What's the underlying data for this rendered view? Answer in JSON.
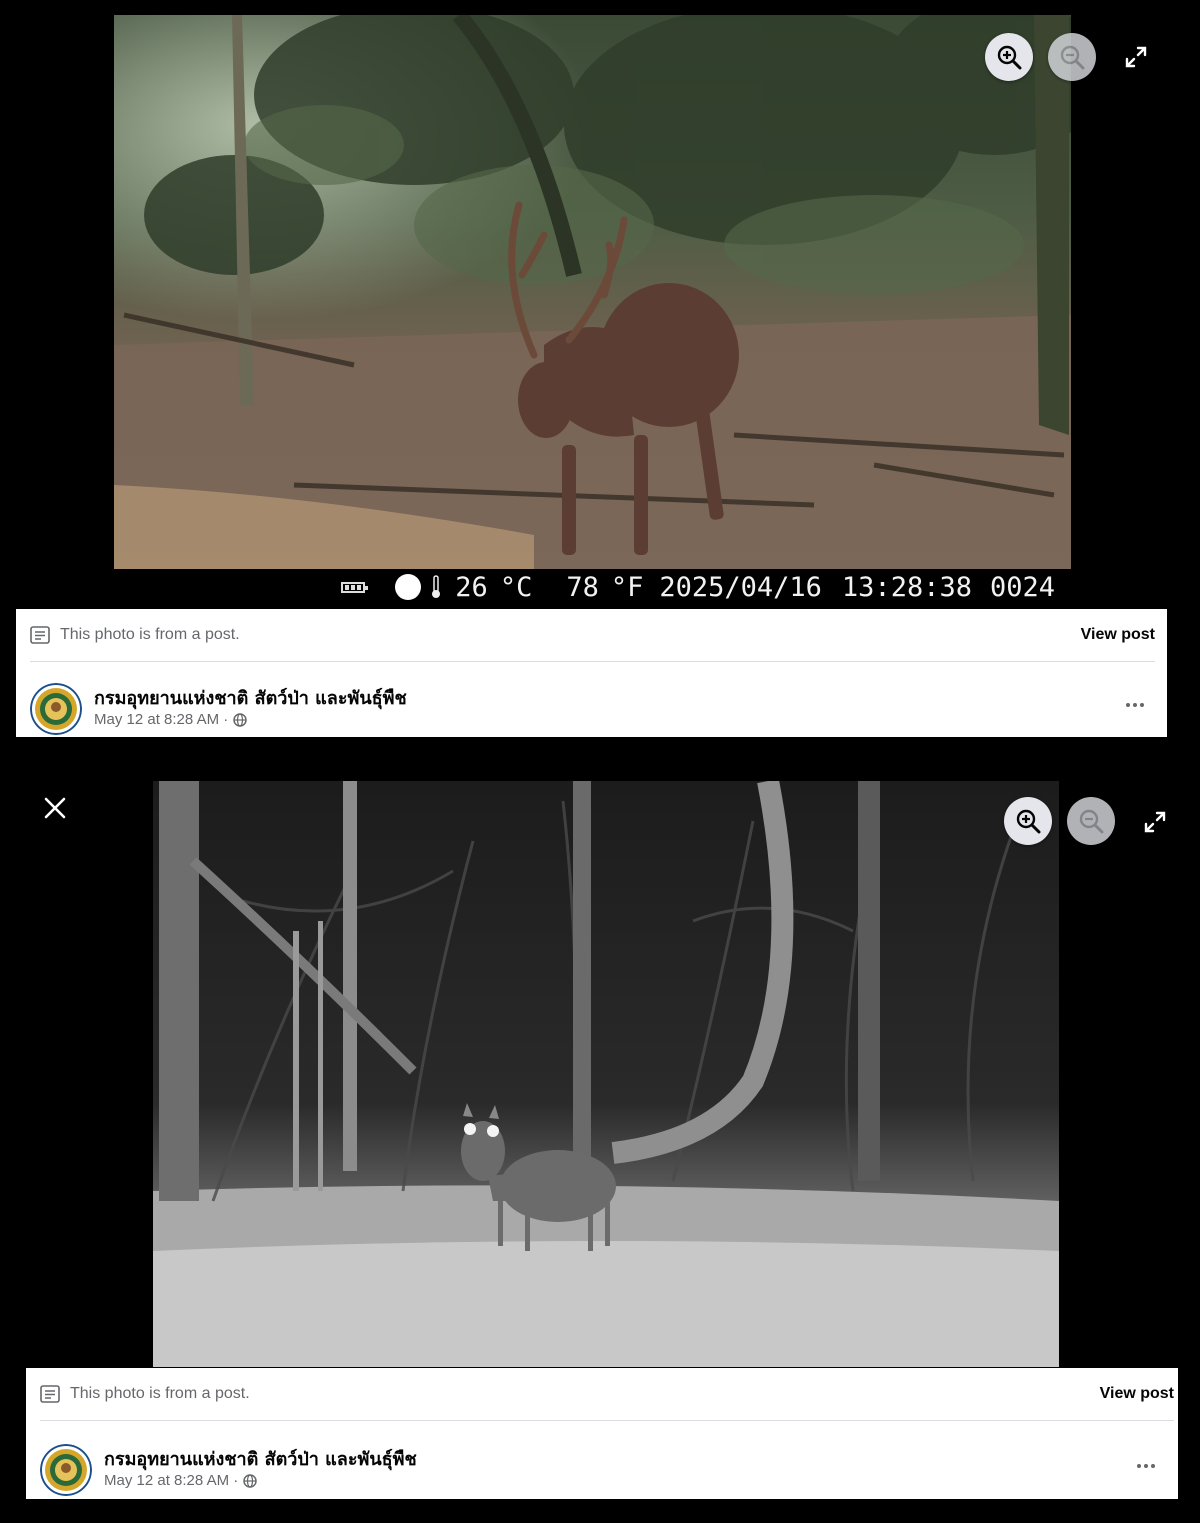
{
  "panel1": {
    "camera_stamp": {
      "temp_c": "26",
      "temp_c_unit": "°C",
      "temp_f": "78",
      "temp_f_unit": "°F",
      "date": "2025/04/16",
      "time": "13:28:38",
      "frame": "0024"
    },
    "post": {
      "note": "This photo is from a post.",
      "view_post": "View post",
      "page_name": "กรมอุทยานแห่งชาติ สัตว์ป่า และพันธุ์พืช",
      "timestamp": "May 12 at 8:28 AM ·"
    }
  },
  "panel2": {
    "post": {
      "note": "This photo is from a post.",
      "view_post": "View post",
      "page_name": "กรมอุทยานแห่งชาติ สัตว์ป่า และพันธุ์พืช",
      "timestamp": "May 12 at 8:28 AM ·"
    }
  },
  "icons": {
    "zoom_in": "zoom-in-icon",
    "zoom_out": "zoom-out-icon",
    "fullscreen": "expand-icon",
    "close": "close-icon",
    "more": "more-icon",
    "audience": "globe-icon",
    "note": "note-icon"
  },
  "colors": {
    "background": "#000000",
    "card": "#ffffff",
    "secondary_text": "#65676b",
    "avatar_ring": "#1b4f8a",
    "avatar_gold": "#d4a62a"
  }
}
